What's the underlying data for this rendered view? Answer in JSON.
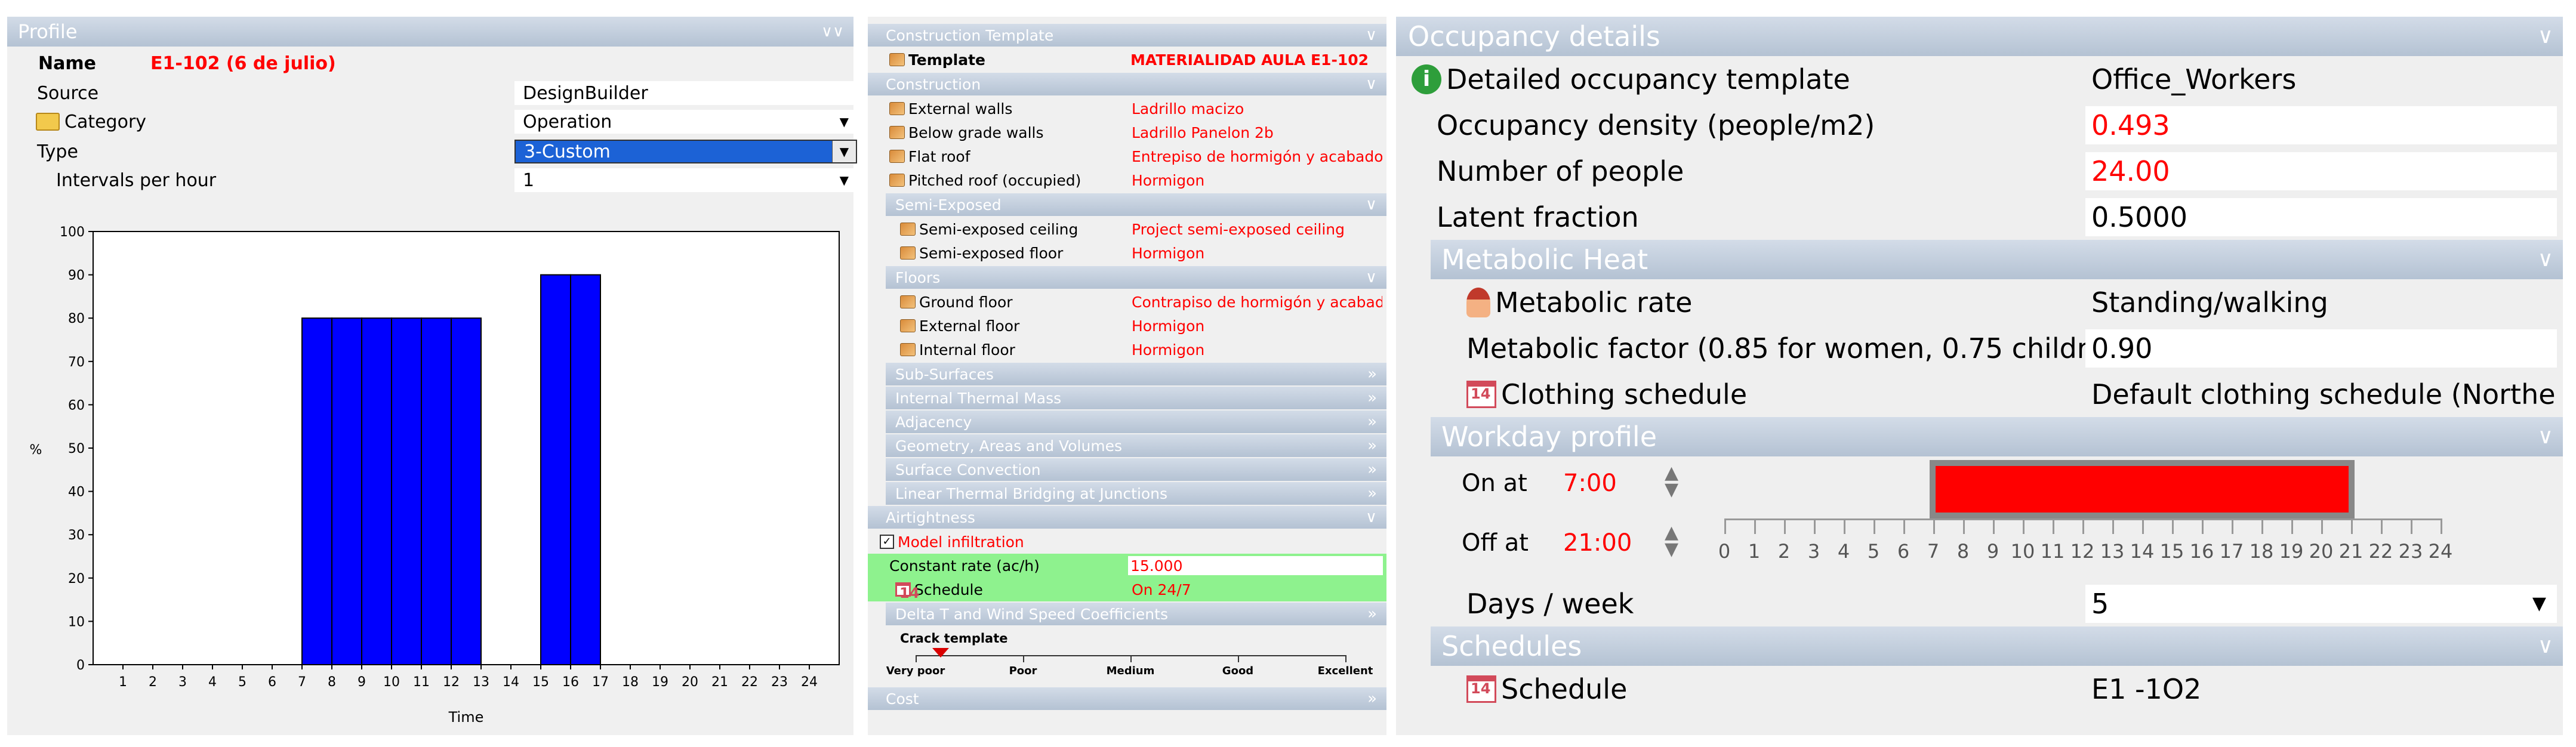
{
  "left": {
    "header": "Profile",
    "name_label": "Name",
    "name_value": "E1-102 (6 de julio)",
    "source_label": "Source",
    "source_value": "DesignBuilder",
    "category_label": "Category",
    "category_value": "Operation",
    "type_label": "Type",
    "type_value": "3-Custom",
    "intervals_label": "Intervals per hour",
    "intervals_value": "1",
    "chart_data": {
      "type": "bar",
      "categories": [
        "1",
        "2",
        "3",
        "4",
        "5",
        "6",
        "7",
        "8",
        "9",
        "10",
        "11",
        "12",
        "13",
        "14",
        "15",
        "16",
        "17",
        "18",
        "19",
        "20",
        "21",
        "22",
        "23",
        "24"
      ],
      "values": [
        0,
        0,
        0,
        0,
        0,
        0,
        0,
        80,
        80,
        80,
        80,
        80,
        80,
        0,
        0,
        90,
        90,
        0,
        0,
        0,
        0,
        0,
        0,
        0
      ],
      "xlabel": "Time",
      "ylabel": "%",
      "ylim": [
        0,
        100
      ],
      "yticks": [
        "0",
        "10",
        "20",
        "30",
        "40",
        "50",
        "60",
        "70",
        "80",
        "90",
        "100"
      ],
      "bar_color": "#0000ff"
    }
  },
  "mid": {
    "header": "Construction Template",
    "template_label": "Template",
    "template_value": "MATERIALIDAD AULA E1-102",
    "construction_header": "Construction",
    "construction_rows": [
      {
        "label": "External walls",
        "value": "Ladrillo macizo"
      },
      {
        "label": "Below grade walls",
        "value": "Ladrillo Panelon 2b"
      },
      {
        "label": "Flat roof",
        "value": "Entrepiso de hormigón y acabado"
      },
      {
        "label": "Pitched roof (occupied)",
        "value": "Hormigon"
      }
    ],
    "semi_header": "Semi-Exposed",
    "semi_rows": [
      {
        "label": "Semi-exposed ceiling",
        "value": "Project semi-exposed ceiling"
      },
      {
        "label": "Semi-exposed floor",
        "value": "Hormigon"
      }
    ],
    "floors_header": "Floors",
    "floor_rows": [
      {
        "label": "Ground floor",
        "value": "Contrapiso de hormigón y acabad"
      },
      {
        "label": "External floor",
        "value": "Hormigon"
      },
      {
        "label": "Internal floor",
        "value": "Hormigon"
      }
    ],
    "collapsed": [
      "Sub-Surfaces",
      "Internal Thermal Mass",
      "Adjacency",
      "Geometry, Areas and Volumes",
      "Surface Convection",
      "Linear Thermal Bridging at Junctions"
    ],
    "airtight_header": "Airtightness",
    "model_infiltration": "Model infiltration",
    "constant_rate_label": "Constant rate (ac/h)",
    "constant_rate_value": "15.000",
    "schedule_label": "Schedule",
    "schedule_value": "On 24/7",
    "delta_header": "Delta T and Wind Speed Coefficients",
    "crack_label": "Crack template",
    "crack_ticks": [
      "Very poor",
      "Poor",
      "Medium",
      "Good",
      "Excellent"
    ],
    "cost_header": "Cost"
  },
  "right": {
    "header": "Occupancy details",
    "detailed_label": "Detailed occupancy template",
    "detailed_value": "Office_Workers",
    "density_label": "Occupancy density (people/m2)",
    "density_value": "0.493",
    "people_label": "Number of people",
    "people_value": "24.00",
    "latent_label": "Latent fraction",
    "latent_value": "0.5000",
    "metabolic_header": "Metabolic Heat",
    "rate_label": "Metabolic rate",
    "rate_value": "Standing/walking",
    "factor_label": "Metabolic factor (0.85 for women, 0.75 childr...",
    "factor_value": "0.90",
    "clothing_label": "Clothing schedule",
    "clothing_value": "Default clothing schedule (Norther",
    "workday_header": "Workday profile",
    "on_label": "On at",
    "on_value": "7:00",
    "off_label": "Off at",
    "off_value": "21:00",
    "timeline_ticks": [
      "0",
      "1",
      "2",
      "3",
      "4",
      "5",
      "6",
      "7",
      "8",
      "9",
      "10",
      "11",
      "12",
      "13",
      "14",
      "15",
      "16",
      "17",
      "18",
      "19",
      "20",
      "21",
      "22",
      "23",
      "24"
    ],
    "on_hour": 7,
    "off_hour": 21,
    "days_label": "Days / week",
    "days_value": "5",
    "schedules_header": "Schedules",
    "schedule_label": "Schedule",
    "schedule_value": "E1 -1O2"
  }
}
